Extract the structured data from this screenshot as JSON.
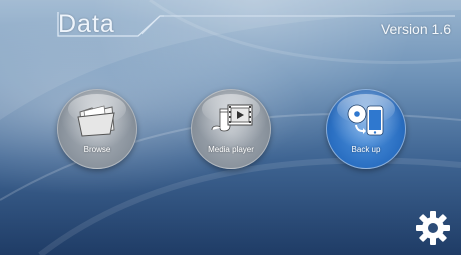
{
  "header": {
    "title": "Data",
    "version": "Version 1.6"
  },
  "tiles": [
    {
      "label": "Browse",
      "icon": "folder-icon",
      "color": "#9aa3ad"
    },
    {
      "label": "Media player",
      "icon": "music-film-icon",
      "color": "#9aa3ad"
    },
    {
      "label": "Back up",
      "icon": "disc-phone-icon",
      "color": "#2f78cf"
    }
  ],
  "settings": {
    "icon": "gear-icon",
    "color": "#ffffff"
  },
  "theme": {
    "background_top": "#9ab5cf",
    "background_bottom": "#1f3c66"
  }
}
